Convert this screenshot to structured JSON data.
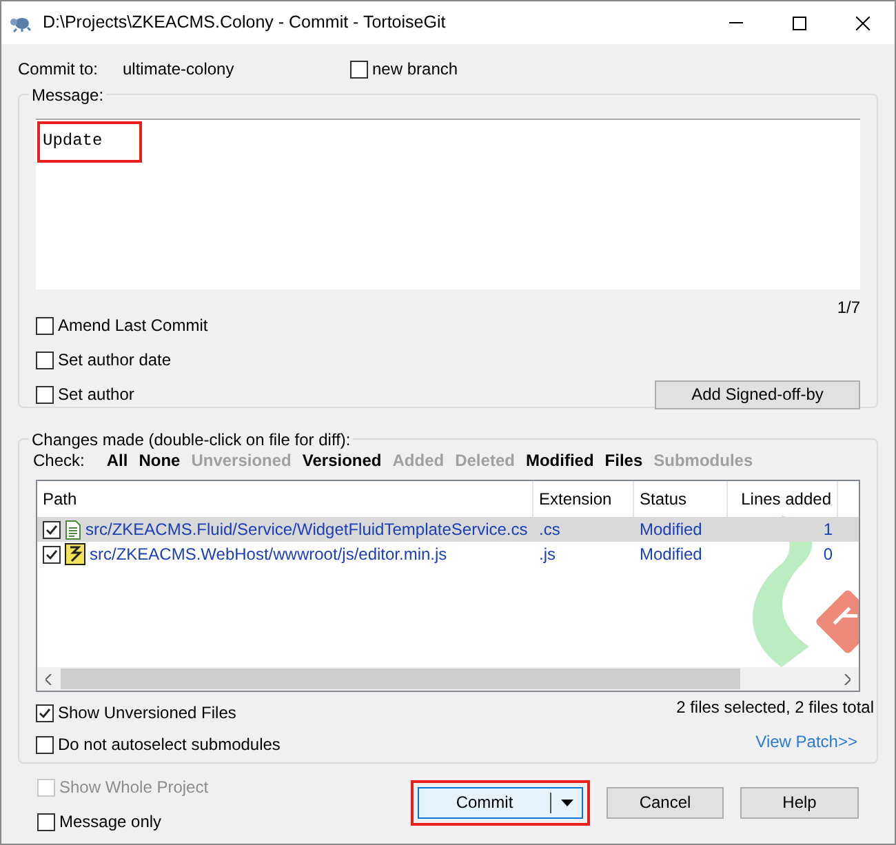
{
  "window": {
    "title": "D:\\Projects\\ZKEACMS.Colony - Commit - TortoiseGit"
  },
  "commit_to": {
    "label": "Commit to:",
    "branch": "ultimate-colony"
  },
  "new_branch": {
    "label": "new branch",
    "checked": false
  },
  "message": {
    "label": "Message:",
    "value": "Update",
    "highlighted": true,
    "counter": "1/7"
  },
  "options": [
    {
      "label": "Amend Last Commit",
      "checked": false
    },
    {
      "label": "Set author date",
      "checked": false
    },
    {
      "label": "Set author",
      "checked": false
    }
  ],
  "signoff_button": "Add Signed-off-by",
  "changes": {
    "label": "Changes made (double-click on file for diff):",
    "check_label": "Check:",
    "filters": [
      {
        "label": "All",
        "disabled": false
      },
      {
        "label": "None",
        "disabled": false
      },
      {
        "label": "Unversioned",
        "disabled": true
      },
      {
        "label": "Versioned",
        "disabled": false
      },
      {
        "label": "Added",
        "disabled": true
      },
      {
        "label": "Deleted",
        "disabled": true
      },
      {
        "label": "Modified",
        "disabled": false
      },
      {
        "label": "Files",
        "disabled": false
      },
      {
        "label": "Submodules",
        "disabled": true
      }
    ],
    "columns": [
      "Path",
      "Extension",
      "Status",
      "Lines added"
    ],
    "rows": [
      {
        "checked": true,
        "selected": true,
        "kind": "text",
        "path": "src/ZKEACMS.Fluid/Service/WidgetFluidTemplateService.cs",
        "extension": ".cs",
        "status": "Modified",
        "lines_added": "1"
      },
      {
        "checked": true,
        "selected": false,
        "kind": "script",
        "path": "src/ZKEACMS.WebHost/wwwroot/js/editor.min.js",
        "extension": ".js",
        "status": "Modified",
        "lines_added": "0"
      }
    ],
    "bottom_options": [
      {
        "label": "Show Unversioned Files",
        "checked": true
      },
      {
        "label": "Do not autoselect submodules",
        "checked": false
      }
    ],
    "summary": "2 files selected, 2 files total",
    "view_patch": "View Patch>>"
  },
  "footer_options": [
    {
      "label": "Show Whole Project",
      "checked": false,
      "disabled": true
    },
    {
      "label": "Message only",
      "checked": false,
      "disabled": false
    }
  ],
  "buttons": [
    {
      "label": "Commit",
      "kind": "split",
      "highlighted": true
    },
    {
      "label": "Cancel",
      "kind": "plain"
    },
    {
      "label": "Help",
      "kind": "plain"
    }
  ]
}
